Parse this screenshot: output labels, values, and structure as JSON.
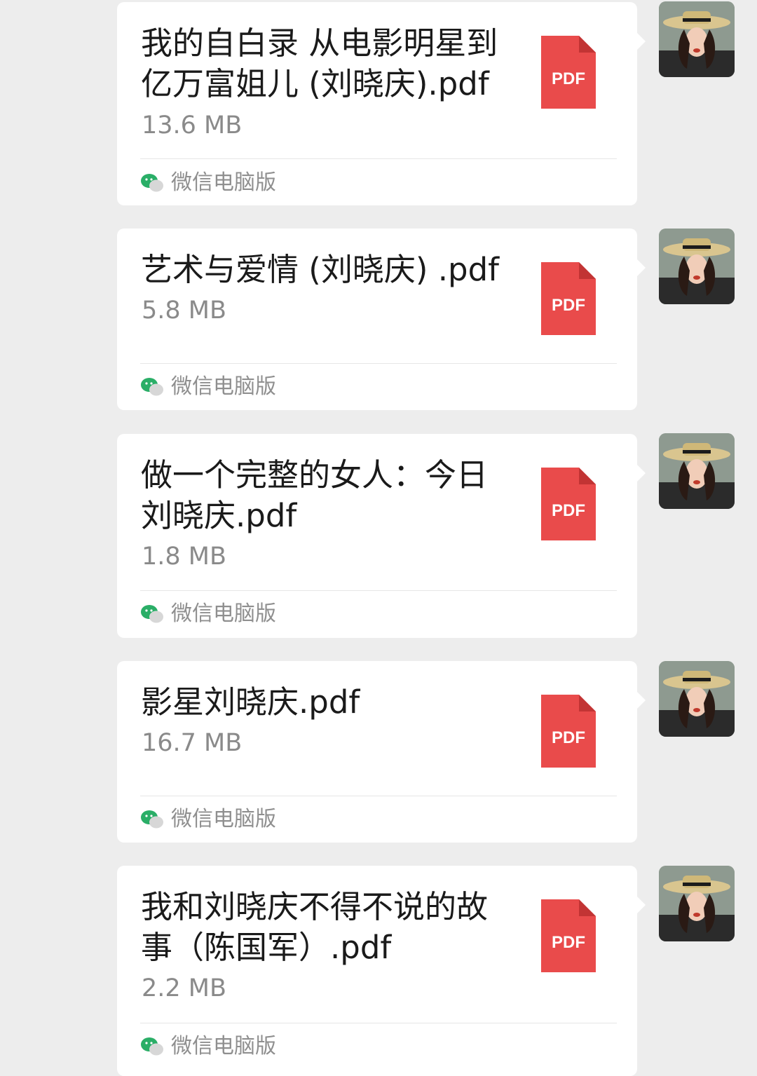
{
  "source_label": "微信电脑版",
  "pdf_icon_label": "PDF",
  "colors": {
    "background": "#ededed",
    "bubble": "#ffffff",
    "pdf_red": "#e94b4b",
    "wechat_green": "#2aae67",
    "size_gray": "#8a8a8a"
  },
  "messages": [
    {
      "file_name": "我的自白录 从电影明星到亿万富姐儿 (刘晓庆).pdf",
      "file_size": "13.6 MB"
    },
    {
      "file_name": "艺术与爱情 (刘晓庆) .pdf",
      "file_size": "5.8 MB"
    },
    {
      "file_name": "做一个完整的女人：今日刘晓庆.pdf",
      "file_size": "1.8 MB"
    },
    {
      "file_name": "影星刘晓庆.pdf",
      "file_size": "16.7 MB"
    },
    {
      "file_name": "我和刘晓庆不得不说的故事（陈国军）.pdf",
      "file_size": "2.2 MB"
    }
  ]
}
